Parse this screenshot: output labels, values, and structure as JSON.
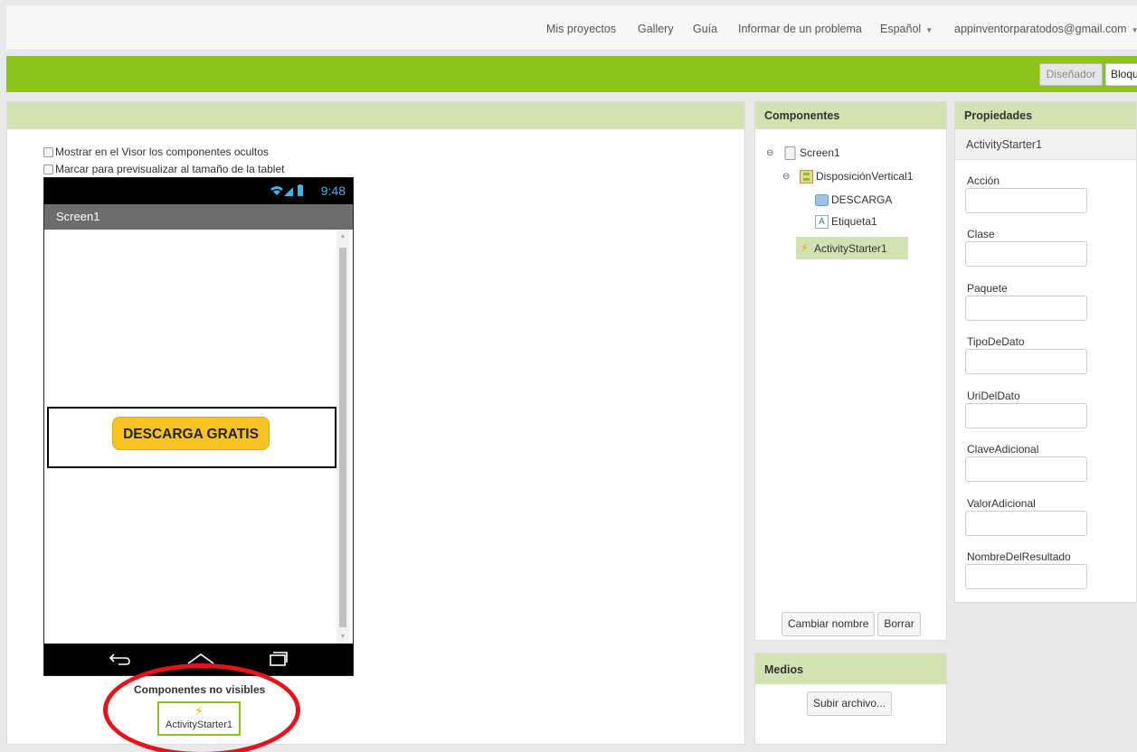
{
  "topnav": {
    "links": [
      "Mis proyectos",
      "Gallery",
      "Guía",
      "Informar de un problema"
    ],
    "language": "Español",
    "account": "appinventorparatodos@gmail.com"
  },
  "toolbar": {
    "designer_label": "Diseñador",
    "blocks_label": "Bloques"
  },
  "viewer": {
    "checkbox_hidden": "Mostrar en el Visor los componentes ocultos",
    "checkbox_tablet": "Marcar para previsualizar al tamaño de la tablet",
    "phone": {
      "time": "9:48",
      "screen_title": "Screen1",
      "button_text": "DESCARGA GRATIS"
    },
    "nonvisible_label": "Componentes no visibles",
    "nonvisible_item": "ActivityStarter1"
  },
  "components": {
    "title": "Componentes",
    "tree": [
      "Screen1",
      "DisposiciónVertical1",
      "DESCARGA",
      "Etiqueta1",
      "ActivityStarter1"
    ],
    "selected": "ActivityStarter1",
    "rename_label": "Cambiar nombre",
    "delete_label": "Borrar"
  },
  "media": {
    "title": "Medios",
    "upload_label": "Subir archivo..."
  },
  "properties": {
    "title": "Propiedades",
    "component": "ActivityStarter1",
    "fields": [
      "Acción",
      "Clase",
      "Paquete",
      "TipoDeDato",
      "UriDelDato",
      "ClaveAdicional",
      "ValorAdicional",
      "NombreDelResultado"
    ]
  },
  "colors": {
    "accent_green": "#8dc21f",
    "panel_header": "#d2e2b3",
    "highlight": "#e8121c"
  }
}
